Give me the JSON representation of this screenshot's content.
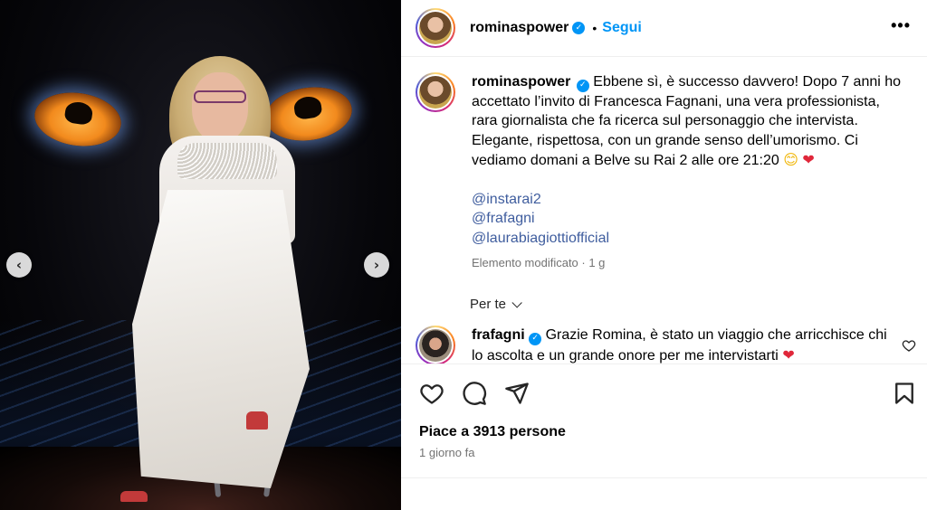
{
  "post": {
    "username": "rominaspower",
    "follow_label": "Segui",
    "separator": "•",
    "more_label": "•••"
  },
  "media": {
    "prev_label": "‹",
    "next_label": "›"
  },
  "caption": {
    "username": "rominaspower",
    "text": "Ebbene sì, è successo davvero! Dopo 7 anni ho accettato l’invito di Francesca Fagnani, una vera professionista, rara giornalista che fa ricerca sul personaggio che intervista. Elegante, rispettosa, con un grande senso dell’umorismo. Ci vediamo domani a Belve su Rai 2 alle ore 21:20",
    "emoji_smile": "😊",
    "emoji_heart": "❤",
    "mentions": [
      "@instarai2",
      "@frafagni",
      "@laurabiagiottiofficial"
    ],
    "meta": "Elemento modificato · 1 g"
  },
  "for_you_label": "Per te",
  "comment": {
    "username": "frafagni",
    "text": "Grazie Romina, è stato un viaggio che arricchisce chi lo ascolta e un grande onore per me intervistarti",
    "emoji_heart": "❤"
  },
  "footer": {
    "likes": "Piace a 3913 persone",
    "time": "1 giorno fa"
  },
  "icons": {
    "like": "heart-outline-icon",
    "comment": "comment-bubble-icon",
    "share": "paper-plane-icon",
    "save": "bookmark-icon",
    "verified": "verified-badge-icon"
  },
  "colors": {
    "accent": "#0095f6",
    "mention": "#3f5d9e",
    "secondary_text": "#737373"
  }
}
